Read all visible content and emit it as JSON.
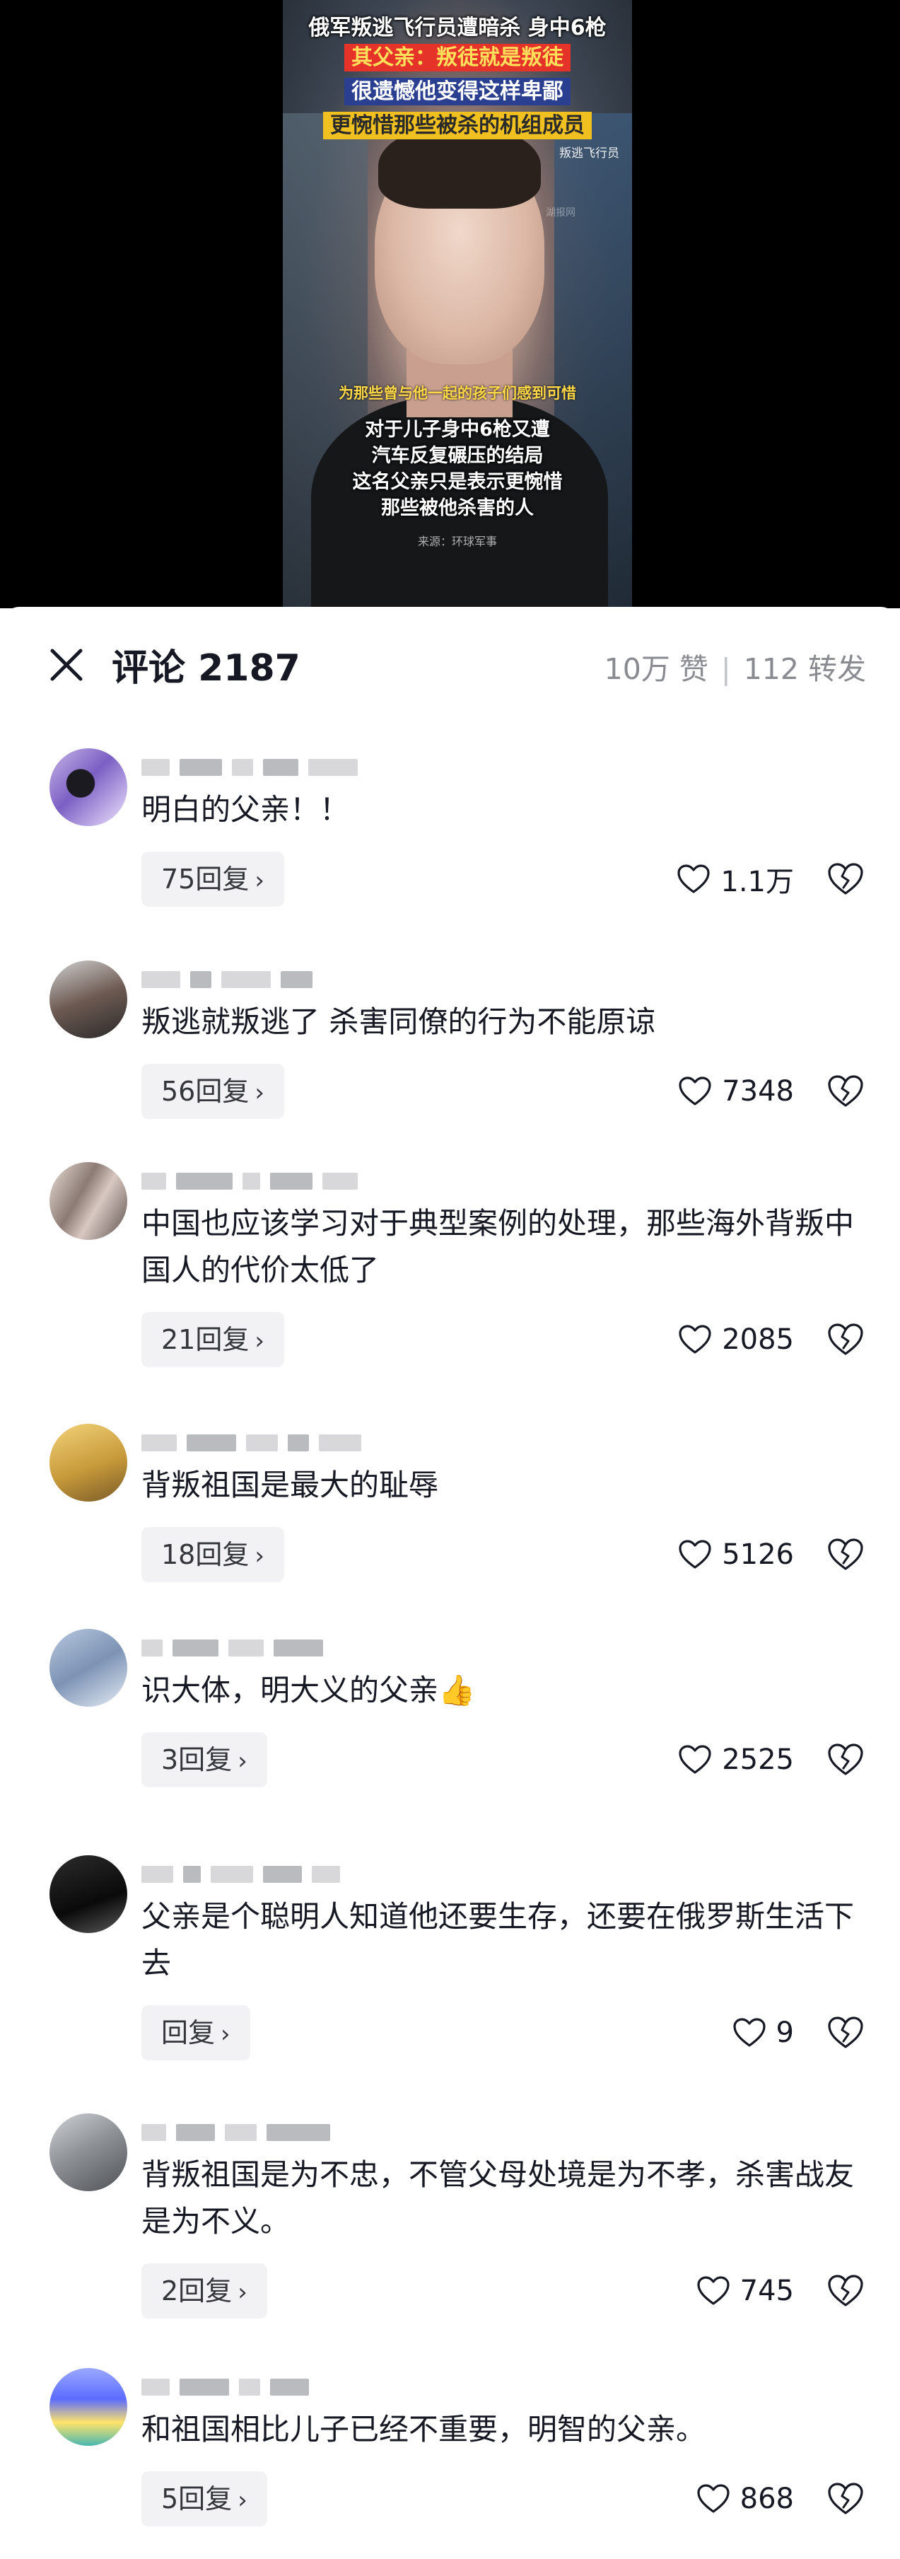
{
  "video": {
    "headline_1": "俄军叛逃飞行员遭暗杀 身中6枪",
    "headline_2": "其父亲：叛徒就是叛徒",
    "headline_3": "很遗憾他变得这样卑鄙",
    "headline_4": "更惋惜那些被杀的机组成员",
    "source_tag": "叛逃飞行员",
    "watermark": "湖报网",
    "yellow_caption": "为那些曾与他一起的孩子们感到可惜",
    "subtitle_1": "对于儿子身中6枪又遭",
    "subtitle_2": "汽车反复碾压的结局",
    "subtitle_3": "这名父亲只是表示更惋惜",
    "subtitle_4": "那些被他杀害的人",
    "source_credit": "来源：环球军事",
    "colors": {
      "caption_red": "#e6332a",
      "caption_blue": "#2a3f8f",
      "caption_yellow": "#f0c020"
    }
  },
  "header": {
    "title": "评论 2187",
    "likes": "10万 赞",
    "divider": "|",
    "shares": "112 转发"
  },
  "comments": [
    {
      "text": "明白的父亲！！",
      "reply_label": "75回复",
      "likes": "1.1万"
    },
    {
      "text": "叛逃就叛逃了 杀害同僚的行为不能原谅",
      "reply_label": "56回复",
      "likes": "7348"
    },
    {
      "text": "中国也应该学习对于典型案例的处理，那些海外背叛中国人的代价太低了",
      "reply_label": "21回复",
      "likes": "2085"
    },
    {
      "text": "背叛祖国是最大的耻辱",
      "reply_label": "18回复",
      "likes": "5126"
    },
    {
      "text": "识大体，明大义的父亲",
      "emoji": "👍",
      "reply_label": "3回复",
      "likes": "2525"
    },
    {
      "text": "父亲是个聪明人知道他还要生存，还要在俄罗斯生活下去",
      "reply_label": "回复",
      "likes": "9"
    },
    {
      "text": "背叛祖国是为不忠，不管父母处境是为不孝，杀害战友是为不义。",
      "reply_label": "2回复",
      "likes": "745"
    },
    {
      "text": "和祖国相比儿子已经不重要，明智的父亲。",
      "reply_label": "5回复",
      "likes": "868"
    }
  ],
  "icons": {
    "close": "close-icon",
    "like": "heart-outline-icon",
    "dislike": "broken-heart-icon",
    "reply_expand": "chevron-right-icon"
  }
}
